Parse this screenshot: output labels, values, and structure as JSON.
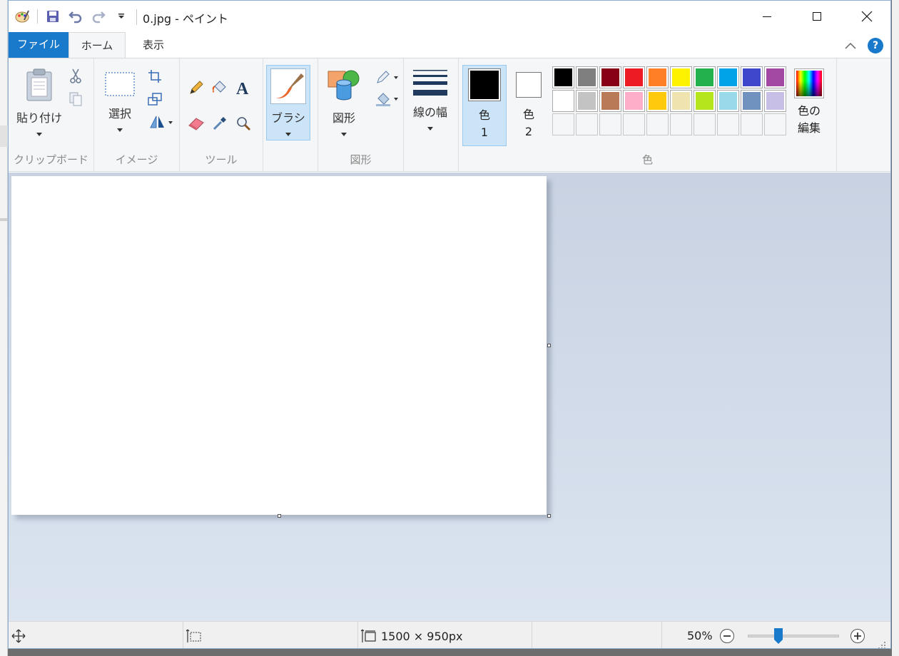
{
  "window": {
    "title": "0.jpg - ペイント",
    "controls": [
      "minimize",
      "maximize",
      "close"
    ]
  },
  "tabs": {
    "file": "ファイル",
    "home": "ホーム",
    "view": "表示"
  },
  "groups": {
    "clipboard": {
      "label": "クリップボード",
      "paste": "貼り付け"
    },
    "image": {
      "label": "イメージ",
      "select": "選択"
    },
    "tools": {
      "label": "ツール"
    },
    "brushes": {
      "label": "ブラシ"
    },
    "shapes": {
      "label": "図形",
      "shapes_btn": "図形"
    },
    "size": {
      "label": "線の幅"
    },
    "colors": {
      "label": "色",
      "color1_line1": "色",
      "color1_line2": "1",
      "color2_line1": "色",
      "color2_line2": "2",
      "edit_line1": "色の",
      "edit_line2": "編集",
      "color1_value": "#000000",
      "color2_value": "#ffffff",
      "palette_row1": [
        "#000000",
        "#7f7f7f",
        "#880015",
        "#ed1c24",
        "#ff7f27",
        "#fff200",
        "#22b14c",
        "#00a2e8",
        "#3f48cc",
        "#a349a4"
      ],
      "palette_row2": [
        "#ffffff",
        "#c3c3c3",
        "#b97a57",
        "#ffaec9",
        "#ffc90e",
        "#efe4b0",
        "#b5e61d",
        "#99d9ea",
        "#7092be",
        "#c8bfe7"
      ],
      "palette_row3_count": 10
    }
  },
  "statusbar": {
    "dimensions": "1500 × 950px",
    "zoom": "50%",
    "zoom_fraction": 0.5
  },
  "accent": "#1979ca"
}
